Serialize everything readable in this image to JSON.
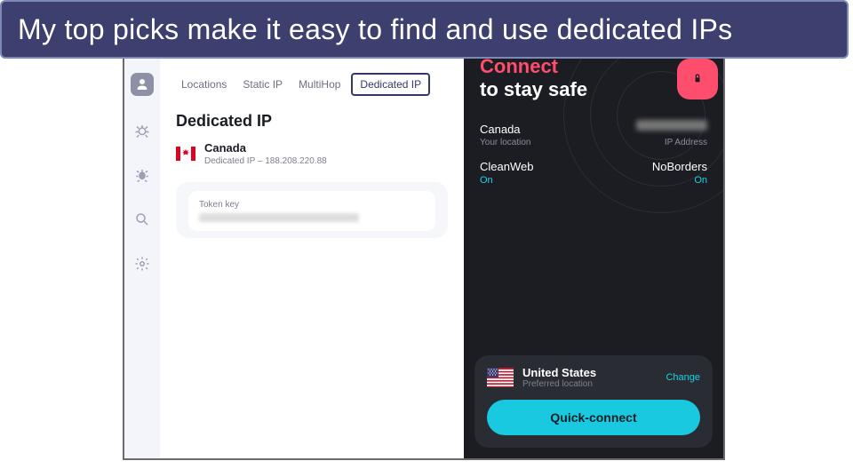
{
  "banner": "My top picks make it easy to find and use dedicated IPs",
  "tabs": {
    "locations": "Locations",
    "static": "Static IP",
    "multihop": "MultiHop",
    "dedicated": "Dedicated IP"
  },
  "heading": "Dedicated IP",
  "dedicated": {
    "country": "Canada",
    "sub": "Dedicated IP – 188.208.220.88"
  },
  "token": {
    "label": "Token key"
  },
  "hero": {
    "connect": "Connect",
    "stay": "to stay safe"
  },
  "status": {
    "location_name": "Canada",
    "location_sub": "Your location",
    "ip_label": "IP Address"
  },
  "features": {
    "cleanweb": "CleanWeb",
    "cleanweb_state": "On",
    "noborders": "NoBorders",
    "noborders_state": "On"
  },
  "preferred": {
    "country": "United States",
    "sub": "Preferred location",
    "change": "Change"
  },
  "quick_connect": "Quick-connect"
}
